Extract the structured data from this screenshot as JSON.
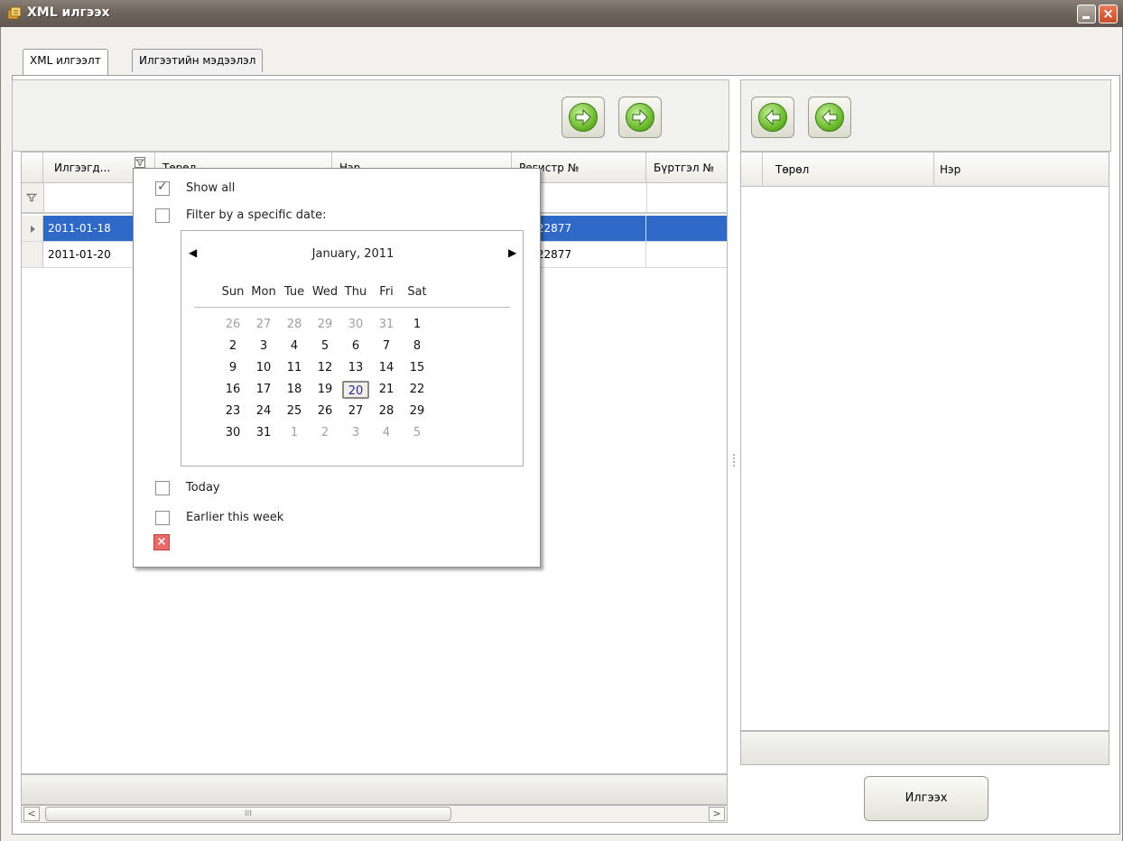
{
  "window": {
    "title": "XML илгээх"
  },
  "tabs": [
    {
      "label": "XML илгээлт"
    },
    {
      "label": "Илгээтийн мэдээлэл"
    }
  ],
  "left_grid": {
    "columns": [
      "Илгээгд...",
      "Төрөл",
      "Нэр",
      "Регистр №",
      "Бүртгэл №"
    ],
    "rows": [
      {
        "date": "2011-01-18",
        "register": "34122877",
        "selected": true
      },
      {
        "date": "2011-01-20",
        "register": "34122877",
        "selected": false
      }
    ],
    "scroll_grip": "III"
  },
  "date_filter": {
    "show_all_label": "Show all",
    "show_all_checked": true,
    "specific_date_label": "Filter by a specific date:",
    "calendar": {
      "month_label": "January, 2011",
      "weekdays": [
        "Sun",
        "Mon",
        "Tue",
        "Wed",
        "Thu",
        "Fri",
        "Sat"
      ],
      "weeks": [
        [
          "26",
          "27",
          "28",
          "29",
          "30",
          "31",
          "1"
        ],
        [
          "2",
          "3",
          "4",
          "5",
          "6",
          "7",
          "8"
        ],
        [
          "9",
          "10",
          "11",
          "12",
          "13",
          "14",
          "15"
        ],
        [
          "16",
          "17",
          "18",
          "19",
          "20",
          "21",
          "22"
        ],
        [
          "23",
          "24",
          "25",
          "26",
          "27",
          "28",
          "29"
        ],
        [
          "30",
          "31",
          "1",
          "2",
          "3",
          "4",
          "5"
        ]
      ],
      "selected_day": "20"
    },
    "today_label": "Today",
    "earlier_week_label": "Earlier this week"
  },
  "right_grid": {
    "columns": [
      "Төрөл",
      "Нэр"
    ]
  },
  "export_button": "Илгээх"
}
